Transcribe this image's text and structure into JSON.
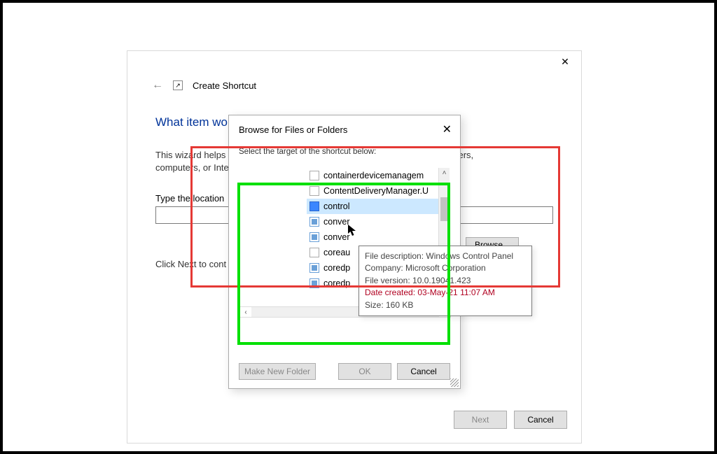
{
  "main": {
    "title": "Create Shortcut",
    "heading": "What item wo",
    "wizard_text_1": "This wizard helps y",
    "wizard_text_2": "s, folders, computers, or Inte",
    "location_label": "Type the location",
    "browse_label": "Browse...",
    "next_text": "Click Next to cont",
    "buttons": {
      "next": "Next",
      "cancel": "Cancel"
    }
  },
  "browse": {
    "title": "Browse for Files or Folders",
    "subtitle": "Select the target of the shortcut below:",
    "items": [
      {
        "name": "containerdevicemanagem",
        "icon": "file"
      },
      {
        "name": "ContentDeliveryManager.U",
        "icon": "file"
      },
      {
        "name": "control",
        "icon": "app",
        "selected": true
      },
      {
        "name": "conver",
        "icon": "sys"
      },
      {
        "name": "conver",
        "icon": "sys"
      },
      {
        "name": "coreau",
        "icon": "file"
      },
      {
        "name": "coredp",
        "icon": "sys"
      },
      {
        "name": "coredp",
        "icon": "sys"
      }
    ],
    "buttons": {
      "make_folder": "Make New Folder",
      "ok": "OK",
      "cancel": "Cancel"
    }
  },
  "tooltip": {
    "l1": "File description: Windows Control Panel",
    "l2": "Company: Microsoft Corporation",
    "l3": "File version: 10.0.19041.423",
    "l4": "Date created: 03-May-21 11:07 AM",
    "l5": "Size: 160 KB"
  }
}
